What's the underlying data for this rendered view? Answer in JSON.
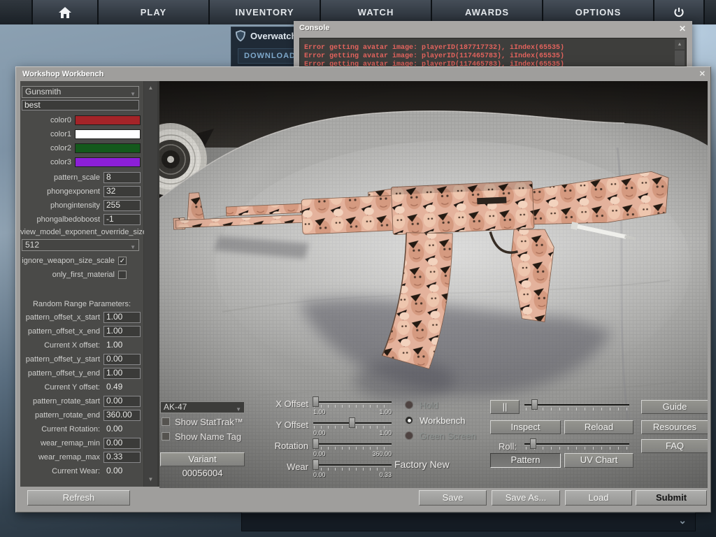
{
  "topbar": {
    "items": [
      "PLAY",
      "INVENTORY",
      "WATCH",
      "AWARDS",
      "OPTIONS"
    ]
  },
  "background": {
    "overwatch": {
      "title": "Overwatch",
      "button": "DOWNLOAD"
    },
    "chevron": "⌄"
  },
  "console": {
    "title": "Console",
    "close": "✕",
    "errors": [
      "Error getting avatar image: playerID(187717732), iIndex(65535)",
      "Error getting avatar image: playerID(117465783), iIndex(65535)",
      "Error getting avatar image: playerID(117465783), iIndex(65535)"
    ]
  },
  "workbench": {
    "title": "Workshop Workbench",
    "close": "✕",
    "finish_style": "Gunsmith",
    "pattern_name": "best",
    "colors": [
      {
        "label": "color0",
        "hex": "#a42428"
      },
      {
        "label": "color1",
        "hex": "#ffffff"
      },
      {
        "label": "color2",
        "hex": "#14591c"
      },
      {
        "label": "color3",
        "hex": "#8c1fd8"
      }
    ],
    "params": [
      {
        "label": "pattern_scale",
        "value": "8"
      },
      {
        "label": "phongexponent",
        "value": "32"
      },
      {
        "label": "phongintensity",
        "value": "255"
      },
      {
        "label": "phongalbedoboost",
        "value": "-1"
      }
    ],
    "size_label": "view_model_exponent_override_size",
    "size_value": "512",
    "checks": [
      {
        "label": "ignore_weapon_size_scale",
        "mark": "✓"
      },
      {
        "label": "only_first_material",
        "mark": ""
      }
    ],
    "random_header": "Random Range Parameters:",
    "random_rows": [
      {
        "label": "pattern_offset_x_start",
        "value": "1.00",
        "is_static": false
      },
      {
        "label": "pattern_offset_x_end",
        "value": "1.00",
        "is_static": false
      },
      {
        "label": "Current X offset:",
        "value": "1.00",
        "is_static": true
      },
      {
        "label": "pattern_offset_y_start",
        "value": "0.00",
        "is_static": false
      },
      {
        "label": "pattern_offset_y_end",
        "value": "1.00",
        "is_static": false
      },
      {
        "label": "Current Y offset:",
        "value": "0.49",
        "is_static": true
      },
      {
        "label": "pattern_rotate_start",
        "value": "0.00",
        "is_static": false
      },
      {
        "label": "pattern_rotate_end",
        "value": "360.00",
        "is_static": false
      },
      {
        "label": "Current Rotation:",
        "value": "0.00",
        "is_static": true
      },
      {
        "label": "wear_remap_min",
        "value": "0.00",
        "is_static": false
      },
      {
        "label": "wear_remap_max",
        "value": "0.33",
        "is_static": false
      },
      {
        "label": "Current Wear:",
        "value": "0.00",
        "is_static": true
      }
    ],
    "weapon": "AK-47",
    "weapon_checks": [
      {
        "label": "Show StatTrak™",
        "mark": ""
      },
      {
        "label": "Show Name Tag",
        "mark": ""
      }
    ],
    "variant_button": "Variant",
    "variant_id": "00056004",
    "sliders": [
      {
        "label": "X Offset",
        "min": "1.00",
        "max": "1.00",
        "pos": "3%"
      },
      {
        "label": "Y Offset",
        "min": "0.00",
        "max": "1.00",
        "pos": "49%"
      },
      {
        "label": "Rotation",
        "min": "0.00",
        "max": "360.00",
        "pos": "3%"
      },
      {
        "label": "Wear",
        "min": "0.00",
        "max": "0.33",
        "pos": "3%"
      }
    ],
    "wear_condition": "Factory New",
    "modes": [
      {
        "label": "Hold",
        "selected": false,
        "disabled": true
      },
      {
        "label": "Workbench",
        "selected": true,
        "disabled": false
      },
      {
        "label": "Green Screen",
        "selected": false,
        "disabled": true
      }
    ],
    "pause_button": "||",
    "anim_slider_pos": "6%",
    "roll_label": "Roll:",
    "roll_slider_pos": "5%",
    "buttons": {
      "guide": "Guide",
      "inspect": "Inspect",
      "reload": "Reload",
      "resources": "Resources",
      "faq": "FAQ",
      "pattern": "Pattern",
      "uv_chart": "UV Chart"
    },
    "footer": {
      "refresh": "Refresh",
      "save": "Save",
      "save_as": "Save As...",
      "load": "Load",
      "submit": "Submit"
    }
  }
}
